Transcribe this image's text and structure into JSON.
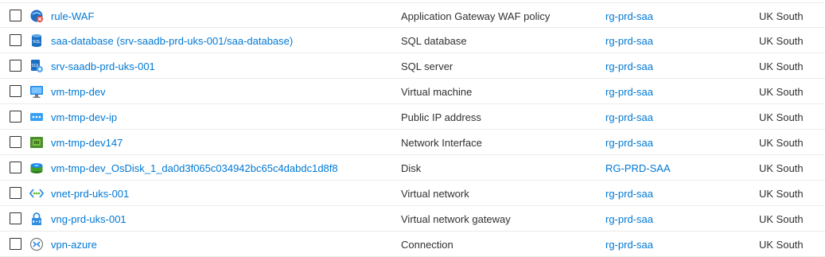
{
  "colors": {
    "link": "#0078d4",
    "text": "#323130",
    "row_border": "#edebe9"
  },
  "rows": [
    {
      "name": "rule-WAF",
      "type": "Application Gateway WAF policy",
      "resource_group": "rg-prd-saa",
      "location": "UK South",
      "icon": "waf-policy-icon"
    },
    {
      "name": "saa-database (srv-saadb-prd-uks-001/saa-database)",
      "type": "SQL database",
      "resource_group": "rg-prd-saa",
      "location": "UK South",
      "icon": "sql-database-icon"
    },
    {
      "name": "srv-saadb-prd-uks-001",
      "type": "SQL server",
      "resource_group": "rg-prd-saa",
      "location": "UK South",
      "icon": "sql-server-icon"
    },
    {
      "name": "vm-tmp-dev",
      "type": "Virtual machine",
      "resource_group": "rg-prd-saa",
      "location": "UK South",
      "icon": "virtual-machine-icon"
    },
    {
      "name": "vm-tmp-dev-ip",
      "type": "Public IP address",
      "resource_group": "rg-prd-saa",
      "location": "UK South",
      "icon": "public-ip-icon"
    },
    {
      "name": "vm-tmp-dev147",
      "type": "Network Interface",
      "resource_group": "rg-prd-saa",
      "location": "UK South",
      "icon": "network-interface-icon"
    },
    {
      "name": "vm-tmp-dev_OsDisk_1_da0d3f065c034942bc65c4dabdc1d8f8",
      "type": "Disk",
      "resource_group": "RG-PRD-SAA",
      "location": "UK South",
      "icon": "disk-icon"
    },
    {
      "name": "vnet-prd-uks-001",
      "type": "Virtual network",
      "resource_group": "rg-prd-saa",
      "location": "UK South",
      "icon": "virtual-network-icon"
    },
    {
      "name": "vng-prd-uks-001",
      "type": "Virtual network gateway",
      "resource_group": "rg-prd-saa",
      "location": "UK South",
      "icon": "vnet-gateway-icon"
    },
    {
      "name": "vpn-azure",
      "type": "Connection",
      "resource_group": "rg-prd-saa",
      "location": "UK South",
      "icon": "connection-icon"
    }
  ]
}
